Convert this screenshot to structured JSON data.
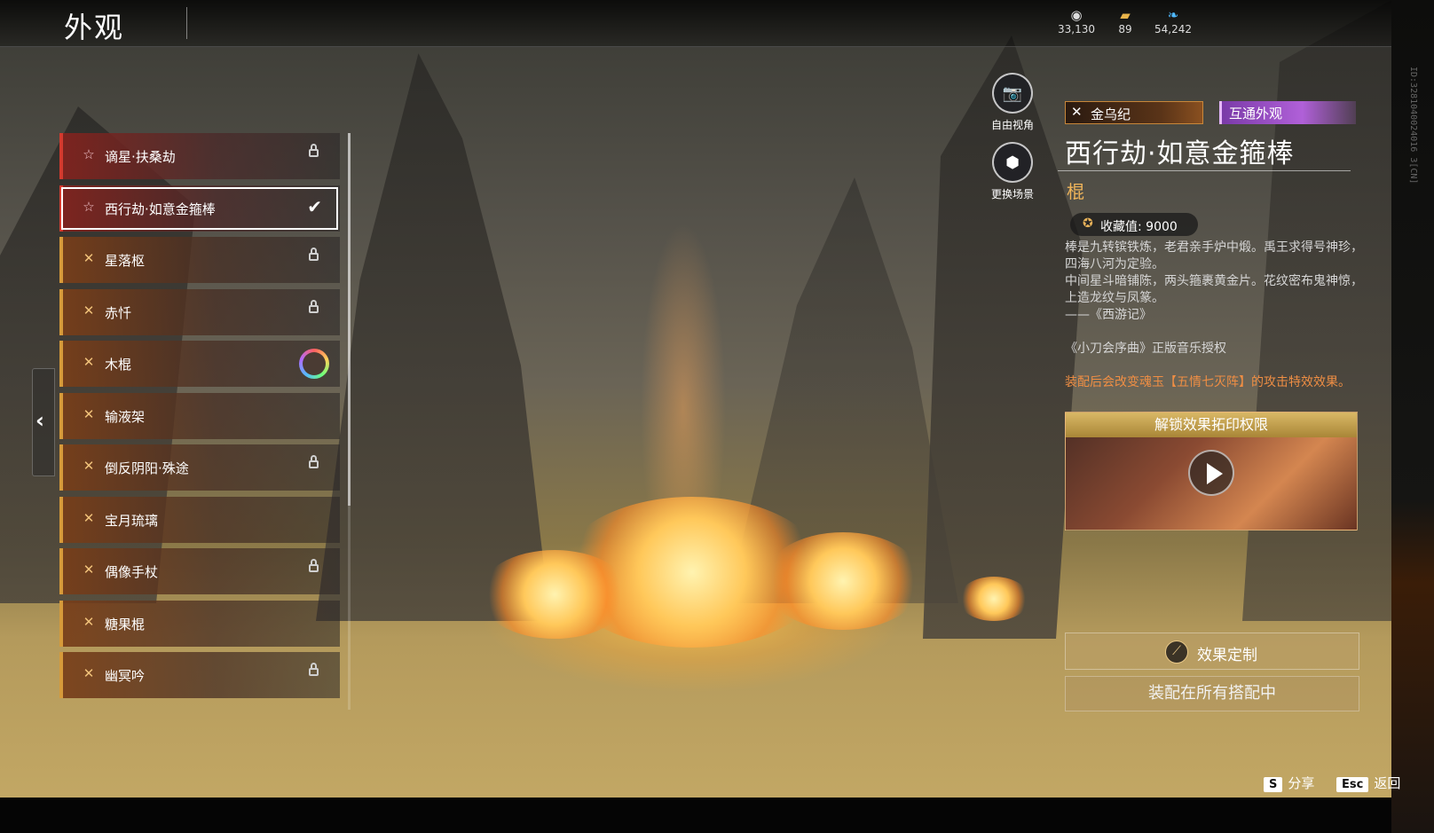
{
  "header": {
    "title": "外观",
    "currencies": [
      {
        "icon": "currency-coin-icon",
        "value": "33,130"
      },
      {
        "icon": "currency-ticket-icon",
        "value": "89"
      },
      {
        "icon": "currency-feather-icon",
        "value": "54,242"
      }
    ]
  },
  "list": {
    "items": [
      {
        "label": "谪星·扶桑劫",
        "rarity": "red",
        "state": "locked"
      },
      {
        "label": "西行劫·如意金箍棒",
        "rarity": "red",
        "state": "selected"
      },
      {
        "label": "星落枢",
        "rarity": "gold",
        "state": "locked"
      },
      {
        "label": "赤忏",
        "rarity": "gold",
        "state": "locked"
      },
      {
        "label": "木棍",
        "rarity": "gold",
        "state": "color-ring"
      },
      {
        "label": "输液架",
        "rarity": "gold",
        "state": ""
      },
      {
        "label": "倒反阴阳·殊途",
        "rarity": "gold",
        "state": "locked"
      },
      {
        "label": "宝月琉璃",
        "rarity": "gold",
        "state": ""
      },
      {
        "label": "偶像手杖",
        "rarity": "gold",
        "state": "locked"
      },
      {
        "label": "糖果棍",
        "rarity": "gold",
        "state": ""
      },
      {
        "label": "幽冥吟",
        "rarity": "gold",
        "state": "locked"
      }
    ]
  },
  "camera": {
    "free_view": "自由视角",
    "change_scene": "更换场景"
  },
  "detail": {
    "series_tag": "金乌纪",
    "shared_tag": "互通外观",
    "name": "西行劫·如意金箍棒",
    "type": "棍",
    "collect_label": "收藏值: 9000",
    "desc_lines": [
      "棒是九转镔铁炼，老君亲手炉中煅。禹王求得号神珍，四海八河为定验。",
      "中间星斗暗铺陈，两头箍裹黄金片。花纹密布鬼神惊，上造龙纹与凤篆。",
      "——《西游记》"
    ],
    "music_license": "《小刀会序曲》正版音乐授权",
    "warning": "装配后会改变魂玉【五情七灭阵】的攻击特效效果。",
    "video_title": "解锁效果拓印权限",
    "custom_button": "效果定制",
    "equip_button": "装配在所有搭配中"
  },
  "hints": {
    "share_key": "S",
    "share_label": "分享",
    "back_key": "Esc",
    "back_label": "返回"
  },
  "build_id": "ID:3281040024016 3[CN]",
  "colors": {
    "accent_gold": "#d69a3a",
    "accent_red": "#d33a2e",
    "type_color": "#f0b55a",
    "warning_color": "#ef8e44"
  }
}
